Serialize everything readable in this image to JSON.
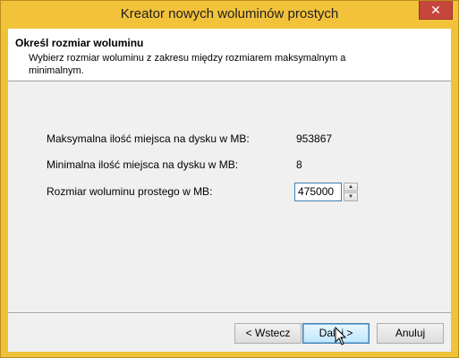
{
  "window": {
    "title": "Kreator nowych woluminów prostych",
    "close_label": "✕"
  },
  "header": {
    "title": "Określ rozmiar woluminu",
    "description": "Wybierz rozmiar woluminu z zakresu między rozmiarem maksymalnym a minimalnym."
  },
  "fields": {
    "max_label": "Maksymalna ilość miejsca na dysku w MB:",
    "max_value": "953867",
    "min_label": "Minimalna ilość miejsca na dysku w MB:",
    "min_value": "8",
    "size_label": "Rozmiar woluminu prostego w MB:",
    "size_value": "475000"
  },
  "buttons": {
    "back": "< Wstecz",
    "next": "Dalej >",
    "cancel": "Anuluj"
  },
  "icons": {
    "spin_up": "▲",
    "spin_down": "▼"
  },
  "colors": {
    "titlebar": "#f2c23b",
    "close": "#c7463c",
    "accent": "#3c7fb1"
  }
}
